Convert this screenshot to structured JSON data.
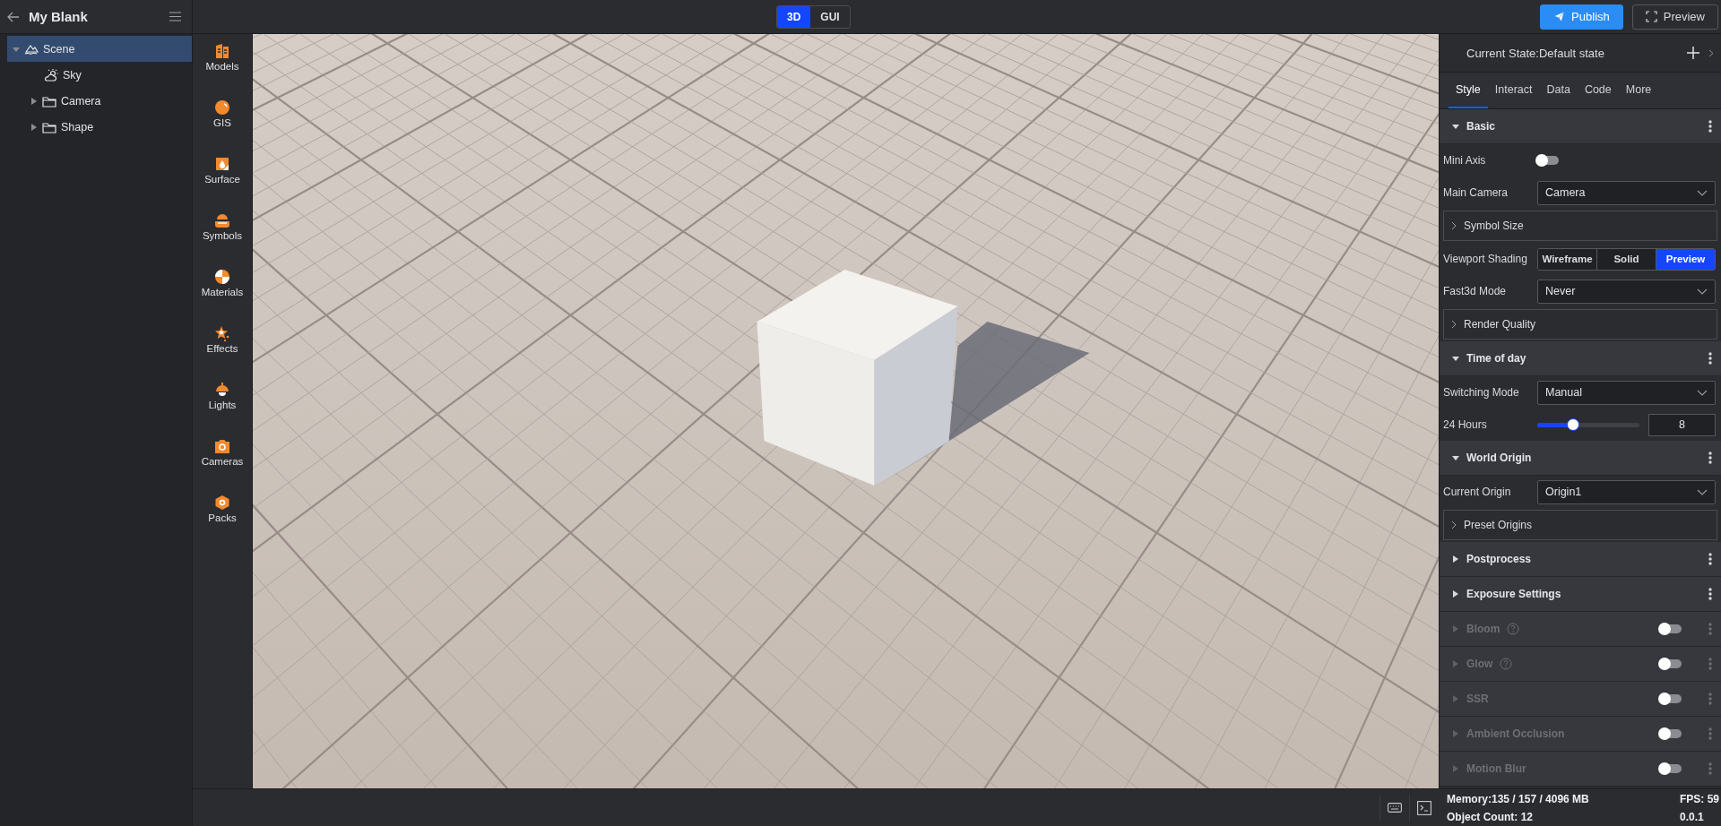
{
  "header": {
    "title": "My Blank"
  },
  "mode_switch": [
    {
      "label": "3D",
      "selected": true
    },
    {
      "label": "GUI",
      "selected": false
    }
  ],
  "top_actions": [
    {
      "label": "Publish",
      "kind": "primary"
    },
    {
      "label": "Preview",
      "kind": "outline"
    }
  ],
  "scene_tree": [
    {
      "label": "Scene",
      "kind": "scene",
      "selected": true,
      "expanded": true,
      "children": [
        {
          "label": "Sky",
          "kind": "sky",
          "selected": false
        },
        {
          "label": "Camera",
          "kind": "folder",
          "selected": false,
          "expanded": false
        },
        {
          "label": "Shape",
          "kind": "folder",
          "selected": false,
          "expanded": false
        }
      ]
    }
  ],
  "asset_toolbar": [
    {
      "label": "Models",
      "kind": "models"
    },
    {
      "label": "GIS",
      "kind": "gis"
    },
    {
      "label": "Surface",
      "kind": "surface"
    },
    {
      "label": "Symbols",
      "kind": "symbols"
    },
    {
      "label": "Materials",
      "kind": "materials"
    },
    {
      "label": "Effects",
      "kind": "effects"
    },
    {
      "label": "Lights",
      "kind": "lights"
    },
    {
      "label": "Cameras",
      "kind": "cameras"
    },
    {
      "label": "Packs",
      "kind": "packs"
    }
  ],
  "right_panel": {
    "state_label": "Current State:Default state",
    "tabs": [
      {
        "label": "Style",
        "selected": true
      },
      {
        "label": "Interact",
        "selected": false
      },
      {
        "label": "Data",
        "selected": false
      },
      {
        "label": "Code",
        "selected": false
      },
      {
        "label": "More",
        "selected": false
      }
    ],
    "sections": [
      {
        "title": "Basic",
        "expanded": true,
        "disabled": false,
        "rows": [
          {
            "kind": "toggle",
            "label": "Mini Axis",
            "on": false
          },
          {
            "kind": "select",
            "label": "Main Camera",
            "value": "Camera"
          },
          {
            "kind": "group",
            "label": "Symbol Size",
            "expanded": false
          },
          {
            "kind": "segmented",
            "label": "Viewport Shading",
            "options": [
              {
                "label": "Wireframe",
                "selected": false
              },
              {
                "label": "Solid",
                "selected": false
              },
              {
                "label": "Preview",
                "selected": true
              }
            ]
          },
          {
            "kind": "select",
            "label": "Fast3d Mode",
            "value": "Never"
          },
          {
            "kind": "group",
            "label": "Render Quality",
            "expanded": false
          }
        ]
      },
      {
        "title": "Time of day",
        "expanded": true,
        "disabled": false,
        "rows": [
          {
            "kind": "select",
            "label": "Switching Mode",
            "value": "Manual"
          },
          {
            "kind": "slider",
            "label": "24 Hours",
            "level": 0.35,
            "value": "8"
          }
        ]
      },
      {
        "title": "World Origin",
        "expanded": true,
        "disabled": false,
        "rows": [
          {
            "kind": "select",
            "label": "Current Origin",
            "value": "Origin1"
          },
          {
            "kind": "group",
            "label": "Preset Origins",
            "expanded": false
          }
        ]
      },
      {
        "title": "Postprocess",
        "expanded": false,
        "disabled": false
      },
      {
        "title": "Exposure Settings",
        "expanded": false,
        "disabled": false
      },
      {
        "title": "Bloom",
        "expanded": false,
        "disabled": true,
        "help": true,
        "on": false
      },
      {
        "title": "Glow",
        "expanded": false,
        "disabled": true,
        "help": true,
        "on": false
      },
      {
        "title": "SSR",
        "expanded": false,
        "disabled": true,
        "on": false
      },
      {
        "title": "Ambient Occlusion",
        "expanded": false,
        "disabled": true,
        "on": false
      },
      {
        "title": "Motion Blur",
        "expanded": false,
        "disabled": true,
        "on": false
      }
    ]
  },
  "status": {
    "memory": "Memory:135 / 157 / 4096 MB",
    "fps": "FPS: 59",
    "object_count": "Object Count: 12",
    "version": "0.0.1"
  }
}
